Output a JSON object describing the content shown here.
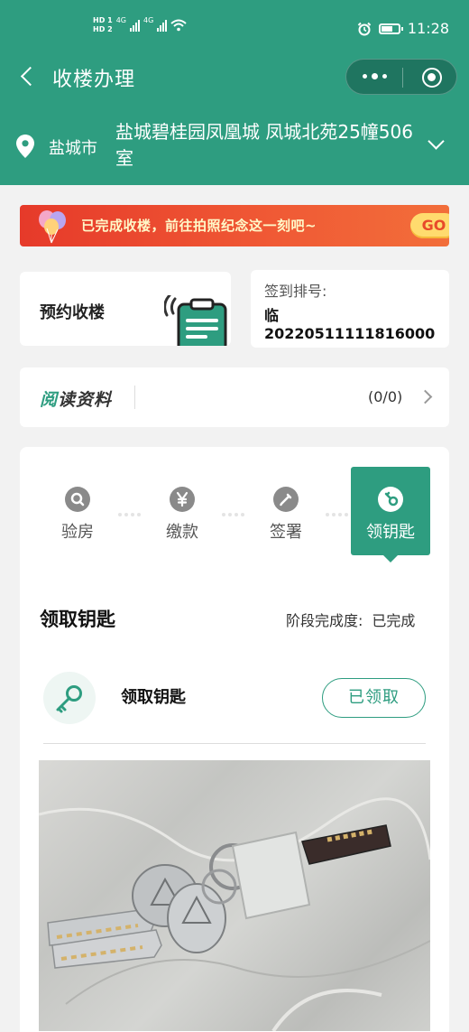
{
  "status_bar": {
    "hd_top": "HD 1",
    "hd_bottom": "HD 2",
    "net1": "4G",
    "net2": "4G",
    "time": "11:28"
  },
  "nav": {
    "title": "收楼办理"
  },
  "address": {
    "city": "盐城市",
    "full": "盐城碧桂园凤凰城 凤城北苑25幢506室"
  },
  "banner": {
    "text": "已完成收楼，前往拍照纪念这一刻吧~",
    "go_label": "GO"
  },
  "appointment": {
    "label": "预约收楼"
  },
  "checkin": {
    "label": "签到排号:",
    "value": "临20220511111816000"
  },
  "reading": {
    "title_part1": "阅",
    "title_part2": "读资料",
    "count": "(0/0)"
  },
  "steps": [
    {
      "label": "验房",
      "icon": "search-icon",
      "active": false
    },
    {
      "label": "缴款",
      "icon": "yen-icon",
      "active": false
    },
    {
      "label": "签署",
      "icon": "pen-icon",
      "active": false
    },
    {
      "label": "领钥匙",
      "icon": "key-icon",
      "active": true
    }
  ],
  "stage": {
    "title": "领取钥匙",
    "progress_label": "阶段完成度:",
    "progress_value": "已完成"
  },
  "key_item": {
    "name": "领取钥匙",
    "status_button": "已领取"
  },
  "colors": {
    "primary": "#2e9d80",
    "banner": "#f05a35",
    "go_button": "#ffdb6e"
  }
}
